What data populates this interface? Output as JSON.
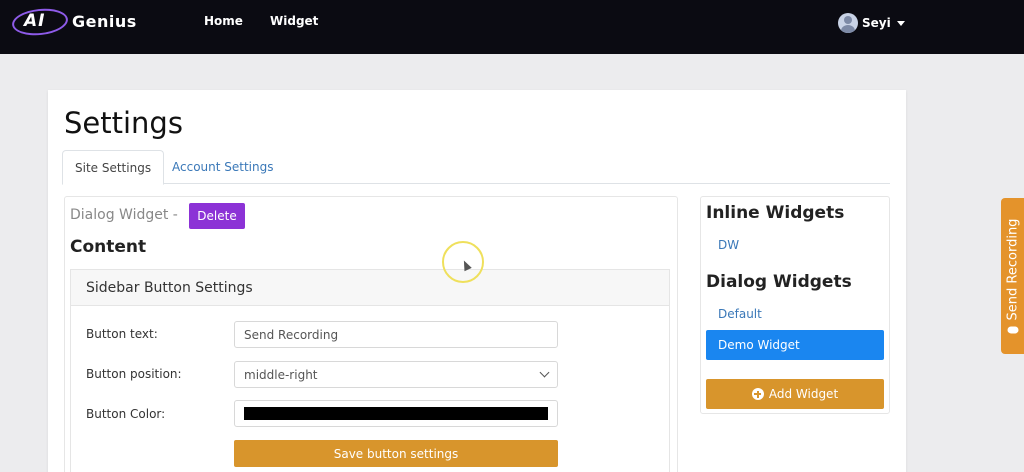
{
  "brand": {
    "logo_ai": "AI",
    "logo_name": "Genius"
  },
  "nav": {
    "home": "Home",
    "widget": "Widget",
    "user": "Seyi"
  },
  "page": {
    "title": "Settings"
  },
  "tabs": [
    {
      "label": "Site Settings",
      "active": true
    },
    {
      "label": "Account Settings",
      "active": false
    }
  ],
  "editor": {
    "widget_title": "Dialog Widget -",
    "delete_label": "Delete",
    "content_heading": "Content"
  },
  "sidebar_button_settings": {
    "title": "Sidebar Button Settings",
    "button_text_label": "Button text:",
    "button_text_value": "Send Recording",
    "button_position_label": "Button position:",
    "button_position_value": "middle-right",
    "button_color_label": "Button Color:",
    "button_color_value": "#000000",
    "save_label": "Save button settings"
  },
  "widgets": {
    "inline_heading": "Inline Widgets",
    "inline_items": [
      "DW"
    ],
    "dialog_heading": "Dialog Widgets",
    "dialog_items": [
      "Default",
      "Demo Widget"
    ],
    "selected": "Demo Widget",
    "add_label": "Add Widget"
  },
  "floating_button": {
    "label": "Send Recording"
  },
  "colors": {
    "navbar": "#0b0b12",
    "delete": "#8c32d6",
    "accent_orange": "#d8952c",
    "selected_blue": "#1a86f0",
    "link_blue": "#3a78b8"
  }
}
